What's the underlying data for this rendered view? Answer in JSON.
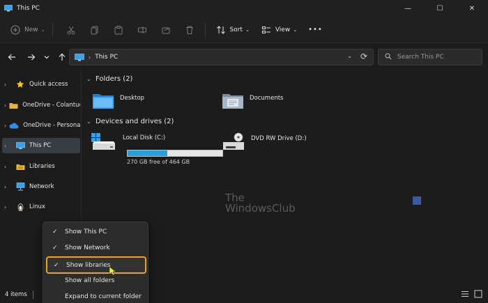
{
  "window": {
    "title": "This PC",
    "controls": {
      "minimize": "—",
      "maximize": "☐",
      "close": "✕"
    }
  },
  "toolbar": {
    "new_label": "New",
    "sort_label": "Sort",
    "view_label": "View",
    "more_label": "•••"
  },
  "address": {
    "breadcrumb": "This PC",
    "separator": "›"
  },
  "search": {
    "placeholder": "Search This PC"
  },
  "sidebar": {
    "items": [
      {
        "label": "Quick access",
        "icon": "star-icon"
      },
      {
        "label": "OneDrive - Colantuc",
        "icon": "folder-icon"
      },
      {
        "label": "OneDrive - Personal",
        "icon": "cloud-icon"
      },
      {
        "label": "This PC",
        "icon": "computer-icon",
        "selected": true
      },
      {
        "label": "Libraries",
        "icon": "libraries-icon"
      },
      {
        "label": "Network",
        "icon": "network-icon"
      },
      {
        "label": "Linux",
        "icon": "linux-penguin-icon"
      }
    ]
  },
  "content": {
    "folders_header": "Folders (2)",
    "folders": [
      {
        "name": "Desktop",
        "icon": "desktop-folder-icon"
      },
      {
        "name": "Documents",
        "icon": "documents-folder-icon"
      }
    ],
    "drives_header": "Devices and drives (2)",
    "drives": [
      {
        "name": "Local Disk (C:)",
        "free_text": "270 GB free of 464 GB",
        "used_fraction": 0.418,
        "icon": "local-disk-icon"
      },
      {
        "name": "DVD RW Drive (D:)",
        "icon": "dvd-drive-icon"
      }
    ]
  },
  "watermark": {
    "line1": "The",
    "line2": "WindowsClub"
  },
  "status": {
    "item_count": "4 items"
  },
  "context_menu": {
    "items": [
      {
        "label": "Show This PC",
        "checked": true,
        "check": "✓"
      },
      {
        "label": "Show Network",
        "checked": true,
        "check": "✓"
      },
      {
        "label": "Show libraries",
        "checked": true,
        "check": "✓",
        "highlighted": true
      },
      {
        "label": "Show all folders",
        "checked": false,
        "check": ""
      },
      {
        "label": "Expand to current folder",
        "checked": false,
        "check": ""
      }
    ]
  },
  "colors": {
    "accent": "#26a0da",
    "highlight_border": "#e8a42a",
    "background": "#1c1c1c",
    "selected_bg": "#383d44"
  }
}
